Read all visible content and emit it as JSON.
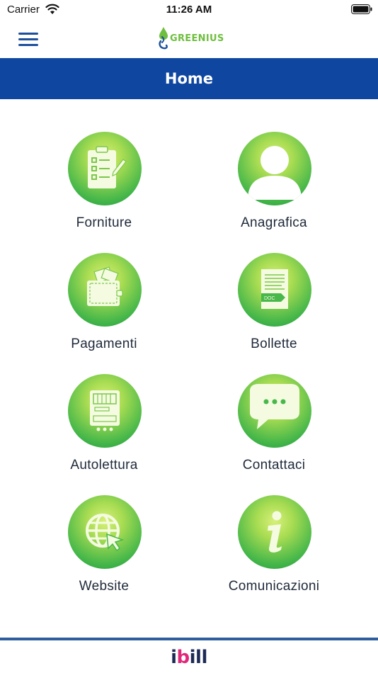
{
  "status_bar": {
    "carrier": "Carrier",
    "time": "11:26 AM"
  },
  "header": {
    "logo_text": "GREENIUS",
    "title": "Home"
  },
  "tiles": [
    {
      "label": "Forniture",
      "icon": "clipboard-checklist-icon"
    },
    {
      "label": "Anagrafica",
      "icon": "user-profile-icon"
    },
    {
      "label": "Pagamenti",
      "icon": "wallet-icon"
    },
    {
      "label": "Bollette",
      "icon": "doc-bill-icon"
    },
    {
      "label": "Autolettura",
      "icon": "meter-icon"
    },
    {
      "label": "Contattaci",
      "icon": "chat-bubble-icon"
    },
    {
      "label": "Website",
      "icon": "globe-cursor-icon"
    },
    {
      "label": "Comunicazioni",
      "icon": "info-icon"
    }
  ],
  "footer": {
    "brand_prefix": "i",
    "brand_accent": "b",
    "brand_suffix": "ill"
  },
  "colors": {
    "header_blue": "#0f47a0",
    "accent_green": "#48b84a",
    "menu_blue": "#1d4f9a",
    "brand_pink": "#e0287a"
  }
}
